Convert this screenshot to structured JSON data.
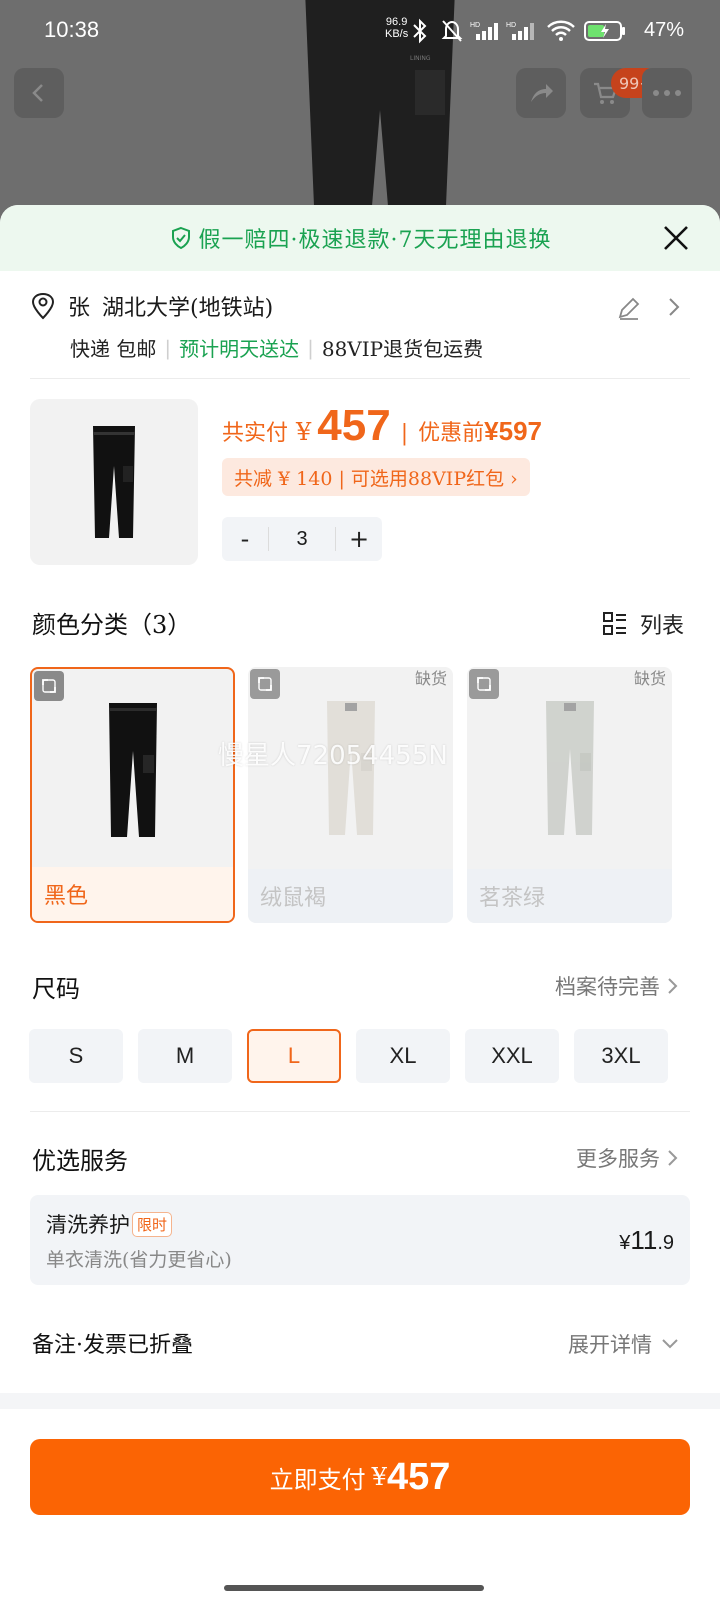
{
  "status_bar": {
    "time": "10:38",
    "net_speed_value": "96.9",
    "net_speed_unit": "KB/s",
    "battery": "47%"
  },
  "background": {
    "cart_badge": "99+"
  },
  "guarantee": {
    "text": "假一赔四·极速退款·7天无理由退换"
  },
  "address": {
    "name": "张",
    "place": "湖北大学(地铁站)",
    "shipping": "快递 包邮",
    "delivery": "预计明天送达",
    "vip_return": "88VIP退货包运费"
  },
  "product": {
    "paid_label": "共实付",
    "currency": "¥",
    "price": "457",
    "before_label": "优惠前",
    "before_price": "¥597",
    "discount_text": "共减 ¥ 140 | 可选用88VIP红包 ›",
    "quantity": "3",
    "minus": "-",
    "plus": "+"
  },
  "colors": {
    "title": "颜色分类（3）",
    "list_toggle": "列表",
    "watermark": "慢星人72054455N",
    "items": [
      {
        "label": "黑色",
        "selected": true
      },
      {
        "label": "绒鼠褐",
        "out_of_stock": "缺货"
      },
      {
        "label": "茗茶绿",
        "out_of_stock": "缺货"
      }
    ]
  },
  "sizes": {
    "title": "尺码",
    "profile_link": "档案待完善",
    "options": [
      "S",
      "M",
      "L",
      "XL",
      "XXL",
      "3XL"
    ],
    "selected": "L"
  },
  "services": {
    "title": "优选服务",
    "more_link": "更多服务",
    "card": {
      "name": "清洗养护",
      "tag": "限时",
      "desc": "单衣清洗(省力更省心)",
      "price_currency": "¥",
      "price_int": "11",
      "price_dec": ".9"
    }
  },
  "notes": {
    "title": "备注·发票已折叠",
    "expand": "展开详情"
  },
  "pay": {
    "label": "立即支付",
    "currency": "¥",
    "amount": "457"
  },
  "theme": {
    "accent": "#fb6404",
    "green": "#1aa251"
  }
}
